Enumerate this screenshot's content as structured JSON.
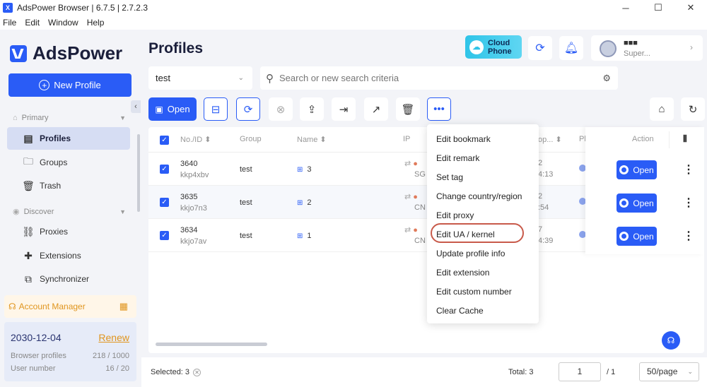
{
  "window": {
    "title": "AdsPower Browser | 6.7.5 | 2.7.2.3",
    "controls": [
      "─",
      "☐",
      "✕"
    ]
  },
  "menu": [
    "File",
    "Edit",
    "Window",
    "Help"
  ],
  "sidebar": {
    "brand": "AdsPower",
    "new_profile": "New Profile",
    "collapse_glyph": "‹",
    "sections": {
      "primary": "Primary",
      "discover": "Discover"
    },
    "items": {
      "profiles": "Profiles",
      "groups": "Groups",
      "trash": "Trash",
      "proxies": "Proxies",
      "extensions": "Extensions",
      "synchronizer": "Synchronizer"
    },
    "account_manager": "Account Manager",
    "subscription": {
      "date": "2030-12-04",
      "renew": "Renew",
      "browser_profiles_label": "Browser profiles",
      "browser_profiles_value": "218 / 1000",
      "user_number_label": "User number",
      "user_number_value": "16 / 20"
    }
  },
  "header": {
    "title": "Profiles",
    "cloud_phone": [
      "Cloud",
      "Phone"
    ],
    "user_name": "■■■",
    "user_role": "Super..."
  },
  "filters": {
    "group_value": "test",
    "search_placeholder": "Search or new search criteria"
  },
  "toolbar": {
    "open_label": "Open"
  },
  "table": {
    "headers": {
      "no_id": "No./ID",
      "group": "Group",
      "name": "Name",
      "ip": "IP",
      "last_open": "op...",
      "platform": "Pl",
      "action": "Action"
    },
    "rows": [
      {
        "no": "3640",
        "id": "kkp4xbv",
        "group": "test",
        "name": "3",
        "ip_country": "SG",
        "last1": "2",
        "last2": "4:13",
        "open": "Open"
      },
      {
        "no": "3635",
        "id": "kkjo7n3",
        "group": "test",
        "name": "2",
        "ip_country": "CN",
        "last1": "2",
        "last2": ":54",
        "open": "Open"
      },
      {
        "no": "3634",
        "id": "kkjo7av",
        "group": "test",
        "name": "1",
        "ip_country": "CN",
        "last1": "7",
        "last2": "4:39",
        "open": "Open"
      }
    ]
  },
  "dropdown": {
    "items": [
      "Edit bookmark",
      "Edit remark",
      "Set tag",
      "Change country/region",
      "Edit proxy",
      "Edit UA / kernel",
      "Update profile info",
      "Edit extension",
      "Edit custom number",
      "Clear Cache"
    ],
    "highlighted": "Edit UA / kernel"
  },
  "footer": {
    "selected": "Selected: 3",
    "total": "Total: 3",
    "page": "1",
    "of_pages": "/ 1",
    "per_page": "50/page"
  },
  "colors": {
    "accent": "#2a5cf6",
    "renew": "#e0951e",
    "highlight_ring": "#c85a4a",
    "cloud_phone": "#2fc4e8"
  }
}
